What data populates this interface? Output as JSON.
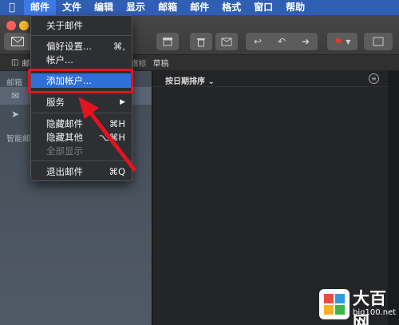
{
  "menubar": {
    "apple_icon": "apple-icon",
    "items": [
      "邮件",
      "文件",
      "编辑",
      "显示",
      "邮箱",
      "邮件",
      "格式",
      "窗口",
      "帮助"
    ]
  },
  "favorites": [
    "邮",
    "有旗标",
    "草稿"
  ],
  "sidebar": {
    "mailboxes_heading": "邮箱",
    "smart_heading": "智能邮"
  },
  "list": {
    "sort_label": "按日期排序 ⌄"
  },
  "mail_menu": {
    "about": "关于邮件",
    "preferences": "偏好设置...",
    "preferences_shortcut": "⌘,",
    "accounts": "帐户...",
    "add_account": "添加帐户...",
    "services": "服务",
    "services_arrow": "▶",
    "hide": "隐藏邮件",
    "hide_shortcut": "⌘H",
    "hide_others": "隐藏其他",
    "hide_others_shortcut": "⌥⌘H",
    "show_all": "全部显示",
    "quit": "退出邮件",
    "quit_shortcut": "⌘Q"
  },
  "colors": {
    "menubar": "#2f5fb3",
    "highlight": "#2e6fd9",
    "annotation": "#e3131f"
  },
  "watermark": {
    "text": "大百网",
    "url": "big100.net"
  }
}
